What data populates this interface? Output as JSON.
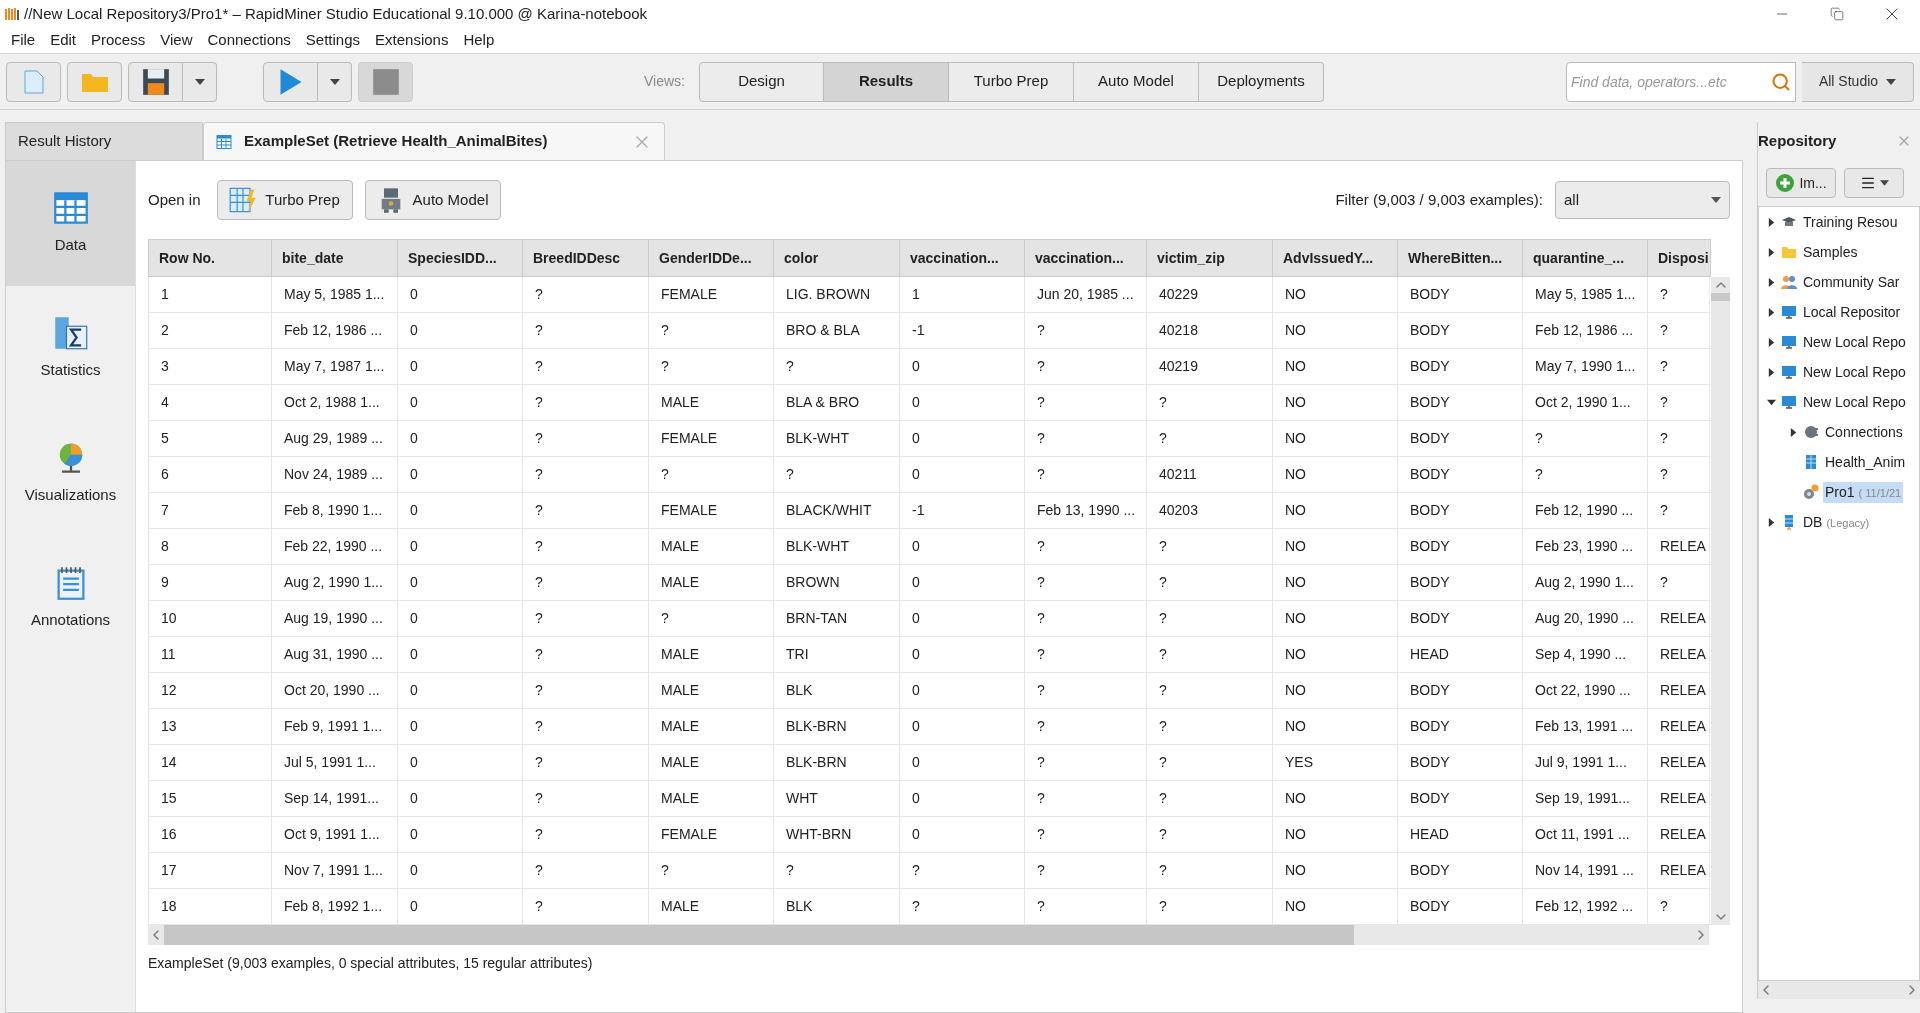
{
  "window": {
    "title": "//New Local Repository3/Pro1* – RapidMiner Studio Educational 9.10.000 @ Karina-notebook"
  },
  "menu": [
    "File",
    "Edit",
    "Process",
    "View",
    "Connections",
    "Settings",
    "Extensions",
    "Help"
  ],
  "toolbar": {
    "views_label": "Views:",
    "views": [
      {
        "label": "Design",
        "selected": false
      },
      {
        "label": "Results",
        "selected": true
      },
      {
        "label": "Turbo Prep",
        "selected": false
      },
      {
        "label": "Auto Model",
        "selected": false
      },
      {
        "label": "Deployments",
        "selected": false
      }
    ],
    "search": {
      "placeholder": "Find data, operators...etc"
    },
    "scope": "All Studio"
  },
  "tabs": [
    {
      "label": "Result History",
      "selected": false
    },
    {
      "label": "ExampleSet (Retrieve Health_AnimalBites)",
      "selected": true
    }
  ],
  "view_sidebar": [
    {
      "label": "Data",
      "kind": "data",
      "selected": true
    },
    {
      "label": "Statistics",
      "kind": "statistics",
      "selected": false
    },
    {
      "label": "Visualizations",
      "kind": "visualizations",
      "selected": false
    },
    {
      "label": "Annotations",
      "kind": "annotations",
      "selected": false
    }
  ],
  "open_in": {
    "label": "Open in",
    "buttons": [
      {
        "label": "Turbo Prep",
        "kind": "turbo"
      },
      {
        "label": "Auto Model",
        "kind": "robot"
      }
    ]
  },
  "filter": {
    "label": "Filter (9,003 / 9,003 examples):",
    "value": "all"
  },
  "table": {
    "columns": [
      "Row No.",
      "bite_date",
      "SpeciesIDD...",
      "BreedIDDesc",
      "GenderIDDe...",
      "color",
      "vaccination...",
      "vaccination...",
      "victim_zip",
      "AdvIssuedY...",
      "WhereBitten...",
      "quarantine_...",
      "Disposi"
    ],
    "rows": [
      [
        "1",
        "May 5, 1985 1...",
        "0",
        "?",
        "FEMALE",
        "LIG. BROWN",
        "1",
        "Jun 20, 1985 ...",
        "40229",
        "NO",
        "BODY",
        "May 5, 1985 1...",
        "?"
      ],
      [
        "2",
        "Feb 12, 1986 ...",
        "0",
        "?",
        "?",
        "BRO & BLA",
        "-1",
        "?",
        "40218",
        "NO",
        "BODY",
        "Feb 12, 1986 ...",
        "?"
      ],
      [
        "3",
        "May 7, 1987 1...",
        "0",
        "?",
        "?",
        "?",
        "0",
        "?",
        "40219",
        "NO",
        "BODY",
        "May 7, 1990 1...",
        "?"
      ],
      [
        "4",
        "Oct 2, 1988 1...",
        "0",
        "?",
        "MALE",
        "BLA & BRO",
        "0",
        "?",
        "?",
        "NO",
        "BODY",
        "Oct 2, 1990 1...",
        "?"
      ],
      [
        "5",
        "Aug 29, 1989 ...",
        "0",
        "?",
        "FEMALE",
        "BLK-WHT",
        "0",
        "?",
        "?",
        "NO",
        "BODY",
        "?",
        "?"
      ],
      [
        "6",
        "Nov 24, 1989 ...",
        "0",
        "?",
        "?",
        "?",
        "0",
        "?",
        "40211",
        "NO",
        "BODY",
        "?",
        "?"
      ],
      [
        "7",
        "Feb 8, 1990 1...",
        "0",
        "?",
        "FEMALE",
        "BLACK/WHIT",
        "-1",
        "Feb 13, 1990 ...",
        "40203",
        "NO",
        "BODY",
        "Feb 12, 1990 ...",
        "?"
      ],
      [
        "8",
        "Feb 22, 1990 ...",
        "0",
        "?",
        "MALE",
        "BLK-WHT",
        "0",
        "?",
        "?",
        "NO",
        "BODY",
        "Feb 23, 1990 ...",
        "RELEA"
      ],
      [
        "9",
        "Aug 2, 1990 1...",
        "0",
        "?",
        "MALE",
        "BROWN",
        "0",
        "?",
        "?",
        "NO",
        "BODY",
        "Aug 2, 1990 1...",
        "?"
      ],
      [
        "10",
        "Aug 19, 1990 ...",
        "0",
        "?",
        "?",
        "BRN-TAN",
        "0",
        "?",
        "?",
        "NO",
        "BODY",
        "Aug 20, 1990 ...",
        "RELEA"
      ],
      [
        "11",
        "Aug 31, 1990 ...",
        "0",
        "?",
        "MALE",
        "TRI",
        "0",
        "?",
        "?",
        "NO",
        "HEAD",
        "Sep 4, 1990 ...",
        "RELEA"
      ],
      [
        "12",
        "Oct 20, 1990 ...",
        "0",
        "?",
        "MALE",
        "BLK",
        "0",
        "?",
        "?",
        "NO",
        "BODY",
        "Oct 22, 1990 ...",
        "RELEA"
      ],
      [
        "13",
        "Feb 9, 1991 1...",
        "0",
        "?",
        "MALE",
        "BLK-BRN",
        "0",
        "?",
        "?",
        "NO",
        "BODY",
        "Feb 13, 1991 ...",
        "RELEA"
      ],
      [
        "14",
        "Jul 5, 1991 1...",
        "0",
        "?",
        "MALE",
        "BLK-BRN",
        "0",
        "?",
        "?",
        "YES",
        "BODY",
        "Jul 9, 1991 1...",
        "RELEA"
      ],
      [
        "15",
        "Sep 14, 1991...",
        "0",
        "?",
        "MALE",
        "WHT",
        "0",
        "?",
        "?",
        "NO",
        "BODY",
        "Sep 19, 1991...",
        "RELEA"
      ],
      [
        "16",
        "Oct 9, 1991 1...",
        "0",
        "?",
        "FEMALE",
        "WHT-BRN",
        "0",
        "?",
        "?",
        "NO",
        "HEAD",
        "Oct 11, 1991 ...",
        "RELEA"
      ],
      [
        "17",
        "Nov 7, 1991 1...",
        "0",
        "?",
        "?",
        "?",
        "?",
        "?",
        "?",
        "NO",
        "BODY",
        "Nov 14, 1991 ...",
        "RELEA"
      ],
      [
        "18",
        "Feb 8, 1992 1...",
        "0",
        "?",
        "MALE",
        "BLK",
        "?",
        "?",
        "?",
        "NO",
        "BODY",
        "Feb 12, 1992 ...",
        "?"
      ]
    ]
  },
  "status": "ExampleSet (9,003 examples, 0 special attributes, 15 regular attributes)",
  "repository": {
    "title": "Repository",
    "import_button": "Im...",
    "tree": [
      {
        "label": "Training Resou",
        "kind": "training",
        "expanded": false,
        "selected": false
      },
      {
        "label": "Samples",
        "kind": "folder",
        "expanded": false,
        "selected": false
      },
      {
        "label": "Community Sar",
        "kind": "community",
        "expanded": false,
        "selected": false
      },
      {
        "label": "Local Repositor",
        "kind": "repo",
        "expanded": false,
        "selected": false
      },
      {
        "label": "New Local Repo",
        "kind": "repo",
        "expanded": false,
        "selected": false
      },
      {
        "label": "New Local Repo",
        "kind": "repo",
        "expanded": false,
        "selected": false
      },
      {
        "label": "New Local Repo",
        "kind": "repo",
        "expanded": true,
        "selected": false,
        "children": [
          {
            "label": "Connections",
            "kind": "connections",
            "expanded": false,
            "selected": false
          },
          {
            "label": "Health_Anim",
            "kind": "data",
            "selected": false
          },
          {
            "label": "Pro1",
            "note": "( 11/1/21",
            "kind": "process",
            "selected": true
          }
        ]
      },
      {
        "label": "DB",
        "note": "(Legacy)",
        "kind": "db",
        "expanded": false,
        "selected": false
      }
    ]
  }
}
